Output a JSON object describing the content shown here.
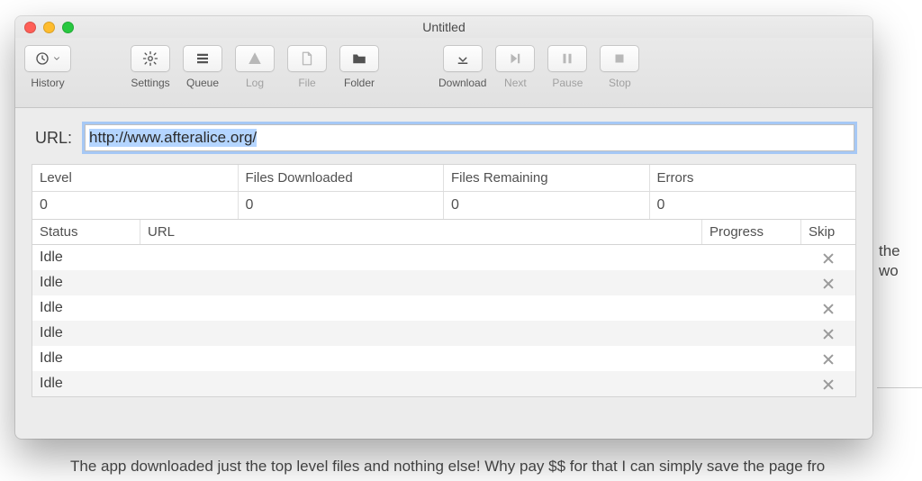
{
  "window": {
    "title": "Untitled"
  },
  "toolbar": {
    "history": "History",
    "settings": "Settings",
    "queue": "Queue",
    "log": "Log",
    "file": "File",
    "folder": "Folder",
    "download": "Download",
    "next": "Next",
    "pause": "Pause",
    "stop": "Stop"
  },
  "url": {
    "label": "URL:",
    "value": "http://www.afteralice.org/"
  },
  "stats": {
    "headers": [
      "Level",
      "Files Downloaded",
      "Files Remaining",
      "Errors"
    ],
    "values": [
      "0",
      "0",
      "0",
      "0"
    ]
  },
  "table": {
    "headers": [
      "Status",
      "URL",
      "Progress",
      "Skip"
    ],
    "rows": [
      {
        "status": "Idle",
        "url": "",
        "progress": ""
      },
      {
        "status": "Idle",
        "url": "",
        "progress": ""
      },
      {
        "status": "Idle",
        "url": "",
        "progress": ""
      },
      {
        "status": "Idle",
        "url": "",
        "progress": ""
      },
      {
        "status": "Idle",
        "url": "",
        "progress": ""
      },
      {
        "status": "Idle",
        "url": "",
        "progress": ""
      }
    ]
  },
  "bg": {
    "right1": "the",
    "right2": "wo",
    "bottom": "The app downloaded just the top level files and nothing else! Why pay $$ for that I can simply save the page fro"
  }
}
